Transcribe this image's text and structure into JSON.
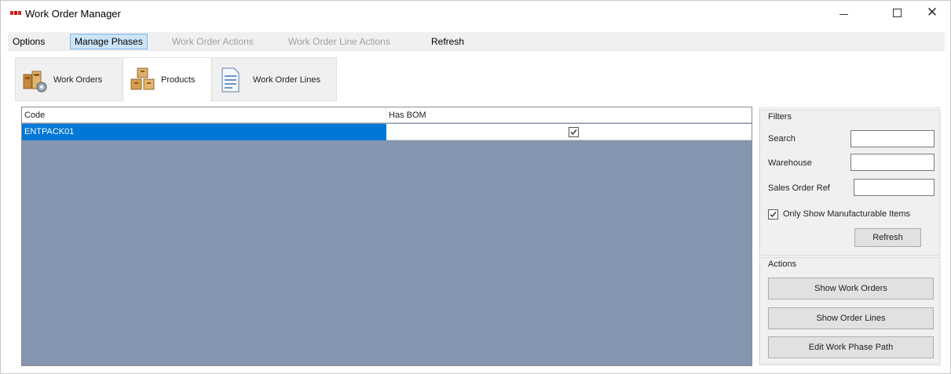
{
  "window": {
    "title": "Work Order Manager",
    "controls": {
      "minimize_icon": "minimize-icon",
      "maximize_icon": "maximize-icon",
      "close_icon": "close-icon"
    }
  },
  "menu": {
    "items": [
      {
        "label": "Options",
        "state": "enabled"
      },
      {
        "label": "Manage Phases",
        "state": "active"
      },
      {
        "label": "Work Order Actions",
        "state": "disabled"
      },
      {
        "label": "Work Order Line Actions",
        "state": "disabled"
      },
      {
        "label": "Refresh",
        "state": "enabled"
      }
    ]
  },
  "toolbar": {
    "tabs": [
      {
        "label": "Work Orders",
        "icon": "work-orders-icon",
        "selected": false
      },
      {
        "label": "Products",
        "icon": "products-icon",
        "selected": true
      },
      {
        "label": "Work Order Lines",
        "icon": "document-icon",
        "selected": false
      }
    ]
  },
  "grid": {
    "columns": [
      "Code",
      "Has BOM"
    ],
    "rows": [
      {
        "code": "ENTPACK01",
        "has_bom": true,
        "selected": true
      }
    ]
  },
  "filters": {
    "title": "Filters",
    "search_label": "Search",
    "search_value": "",
    "warehouse_label": "Warehouse",
    "warehouse_value": "",
    "sales_order_ref_label": "Sales Order Ref",
    "sales_order_ref_value": "",
    "only_manufacturable_label": "Only Show Manufacturable Items",
    "only_manufacturable_checked": true,
    "refresh_label": "Refresh"
  },
  "actions": {
    "title": "Actions",
    "show_work_orders_label": "Show Work Orders",
    "show_order_lines_label": "Show Order Lines",
    "edit_work_phase_path_label": "Edit Work Phase Path"
  },
  "colors": {
    "selection": "#0078d7",
    "grid_background": "#8496b0",
    "menu_active_bg": "#cce4f7",
    "menu_active_border": "#7eb4ea",
    "brand_red": "#e0241b"
  }
}
